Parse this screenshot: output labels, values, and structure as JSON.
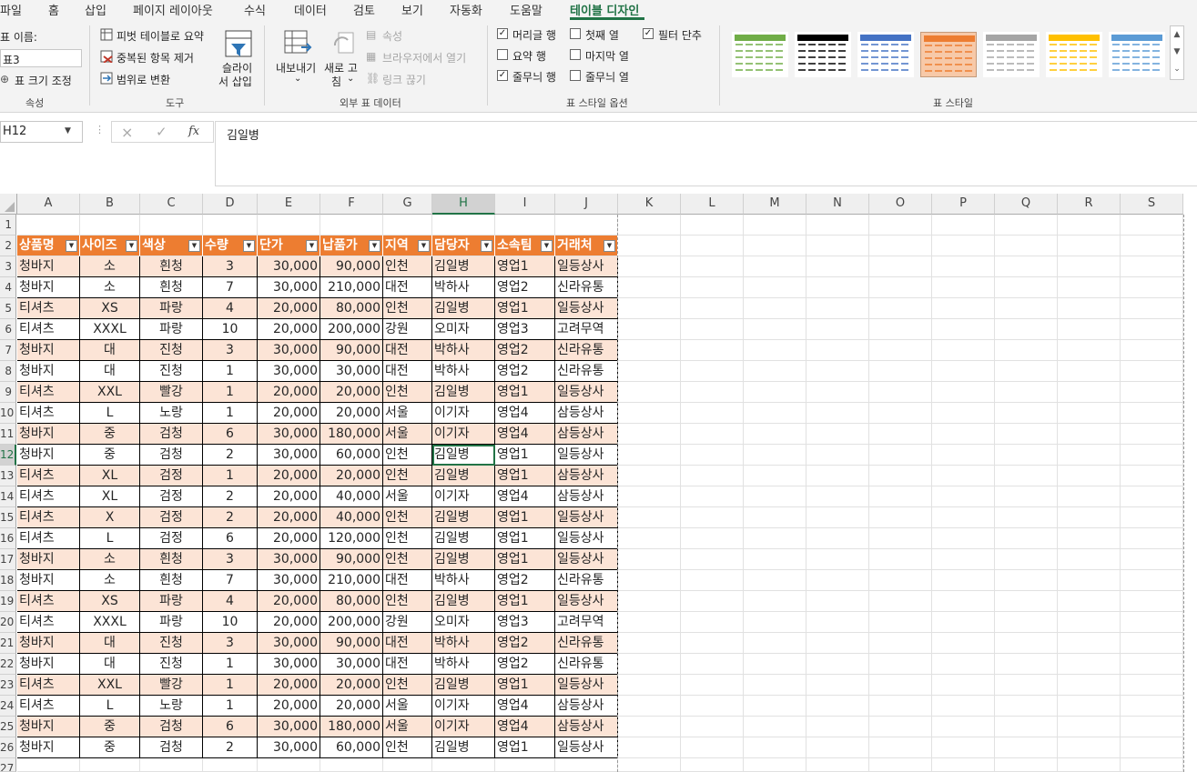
{
  "menu_tabs": [
    "파일",
    "홈",
    "삽입",
    "페이지 레이아웃",
    "수식",
    "데이터",
    "검토",
    "보기",
    "자동화",
    "도움말",
    "테이블 디자인"
  ],
  "active_tab": "테이블 디자인",
  "ribbon": {
    "properties": {
      "name_label": "표 이름:",
      "name_value": "표3",
      "resize_label": "표 크기 조정",
      "group": "속성"
    },
    "tools": {
      "pivot": "피벗 테이블로 요약",
      "remove_dup": "중복된 항목 제거",
      "convert": "범위로 변환",
      "slicer_l1": "슬라이",
      "slicer_l2": "서 삽입",
      "group": "도구"
    },
    "external": {
      "export_l1": "내보내기",
      "refresh_l1": "새로 고",
      "refresh_l2": "침",
      "properties": "속성",
      "open_browser": "브라우저에서 열기",
      "unlink": "링크 끊기",
      "group": "외부 표 데이터"
    },
    "options": {
      "header_row": "머리글 행",
      "total_row": "요약 행",
      "banded_rows": "줄무늬 행",
      "first_col": "첫째 열",
      "last_col": "마지막 열",
      "banded_cols": "줄무늬 열",
      "filter_btn": "필터 단추",
      "group": "표 스타일 옵션",
      "checked": {
        "header_row": true,
        "total_row": false,
        "banded_rows": true,
        "first_col": false,
        "last_col": false,
        "banded_cols": false,
        "filter_btn": true
      }
    },
    "styles": {
      "group": "표 스타일",
      "colors": [
        "#70ad47",
        "#000000",
        "#4472c4",
        "#ed7d31",
        "#a5a5a5",
        "#ffc000",
        "#5b9bd5"
      ],
      "selected": 3
    }
  },
  "formula_bar": {
    "name_box": "H12",
    "cancel_icon": "×",
    "enter_icon": "✓",
    "fx_label": "fx",
    "value": "김일병"
  },
  "grid": {
    "columns": [
      "A",
      "B",
      "C",
      "D",
      "E",
      "F",
      "G",
      "H",
      "I",
      "J",
      "K",
      "L",
      "M",
      "N",
      "O",
      "P",
      "Q",
      "R",
      "S"
    ],
    "selected_col": "H",
    "rows": [
      "1",
      "2",
      "3",
      "4",
      "5",
      "6",
      "7",
      "8",
      "9",
      "10",
      "11",
      "12",
      "13",
      "14",
      "15",
      "16",
      "17",
      "18",
      "19",
      "20",
      "21",
      "22",
      "23",
      "24",
      "25",
      "26",
      "27"
    ],
    "headers": [
      "상품명",
      "사이즈",
      "색상",
      "수량",
      "단가",
      "납품가",
      "지역",
      "담당자",
      "소속팀",
      "거래처"
    ],
    "data": [
      [
        "청바지",
        "소",
        "흰청",
        "3",
        "30,000",
        "90,000",
        "인천",
        "김일병",
        "영업1",
        "일등상사"
      ],
      [
        "청바지",
        "소",
        "흰청",
        "7",
        "30,000",
        "210,000",
        "대전",
        "박하사",
        "영업2",
        "신라유통"
      ],
      [
        "티셔츠",
        "XS",
        "파랑",
        "4",
        "20,000",
        "80,000",
        "인천",
        "김일병",
        "영업1",
        "일등상사"
      ],
      [
        "티셔츠",
        "XXXL",
        "파랑",
        "10",
        "20,000",
        "200,000",
        "강원",
        "오미자",
        "영업3",
        "고려무역"
      ],
      [
        "청바지",
        "대",
        "진청",
        "3",
        "30,000",
        "90,000",
        "대전",
        "박하사",
        "영업2",
        "신라유통"
      ],
      [
        "청바지",
        "대",
        "진청",
        "1",
        "30,000",
        "30,000",
        "대전",
        "박하사",
        "영업2",
        "신라유통"
      ],
      [
        "티셔츠",
        "XXL",
        "빨강",
        "1",
        "20,000",
        "20,000",
        "인천",
        "김일병",
        "영업1",
        "일등상사"
      ],
      [
        "티셔츠",
        "L",
        "노랑",
        "1",
        "20,000",
        "20,000",
        "서울",
        "이기자",
        "영업4",
        "삼등상사"
      ],
      [
        "청바지",
        "중",
        "검청",
        "6",
        "30,000",
        "180,000",
        "서울",
        "이기자",
        "영업4",
        "삼등상사"
      ],
      [
        "청바지",
        "중",
        "검청",
        "2",
        "30,000",
        "60,000",
        "인천",
        "김일병",
        "영업1",
        "일등상사"
      ],
      [
        "티셔츠",
        "XL",
        "검정",
        "1",
        "20,000",
        "20,000",
        "인천",
        "김일병",
        "영업1",
        "삼등상사"
      ],
      [
        "티셔츠",
        "XL",
        "검정",
        "2",
        "20,000",
        "40,000",
        "서울",
        "이기자",
        "영업4",
        "삼등상사"
      ],
      [
        "티셔츠",
        "X",
        "검정",
        "2",
        "20,000",
        "40,000",
        "인천",
        "김일병",
        "영업1",
        "일등상사"
      ],
      [
        "티셔츠",
        "L",
        "검정",
        "6",
        "20,000",
        "120,000",
        "인천",
        "김일병",
        "영업1",
        "일등상사"
      ],
      [
        "청바지",
        "소",
        "흰청",
        "3",
        "30,000",
        "90,000",
        "인천",
        "김일병",
        "영업1",
        "일등상사"
      ],
      [
        "청바지",
        "소",
        "흰청",
        "7",
        "30,000",
        "210,000",
        "대전",
        "박하사",
        "영업2",
        "신라유통"
      ],
      [
        "티셔츠",
        "XS",
        "파랑",
        "4",
        "20,000",
        "80,000",
        "인천",
        "김일병",
        "영업1",
        "일등상사"
      ],
      [
        "티셔츠",
        "XXXL",
        "파랑",
        "10",
        "20,000",
        "200,000",
        "강원",
        "오미자",
        "영업3",
        "고려무역"
      ],
      [
        "청바지",
        "대",
        "진청",
        "3",
        "30,000",
        "90,000",
        "대전",
        "박하사",
        "영업2",
        "신라유통"
      ],
      [
        "청바지",
        "대",
        "진청",
        "1",
        "30,000",
        "30,000",
        "대전",
        "박하사",
        "영업2",
        "신라유통"
      ],
      [
        "티셔츠",
        "XXL",
        "빨강",
        "1",
        "20,000",
        "20,000",
        "인천",
        "김일병",
        "영업1",
        "일등상사"
      ],
      [
        "티셔츠",
        "L",
        "노랑",
        "1",
        "20,000",
        "20,000",
        "서울",
        "이기자",
        "영업4",
        "삼등상사"
      ],
      [
        "청바지",
        "중",
        "검청",
        "6",
        "30,000",
        "180,000",
        "서울",
        "이기자",
        "영업4",
        "삼등상사"
      ],
      [
        "청바지",
        "중",
        "검청",
        "2",
        "30,000",
        "60,000",
        "인천",
        "김일병",
        "영업1",
        "일등상사"
      ]
    ],
    "active_cell": "H12",
    "header_color": "#ed7d31",
    "band_color": "#fce4d6"
  }
}
